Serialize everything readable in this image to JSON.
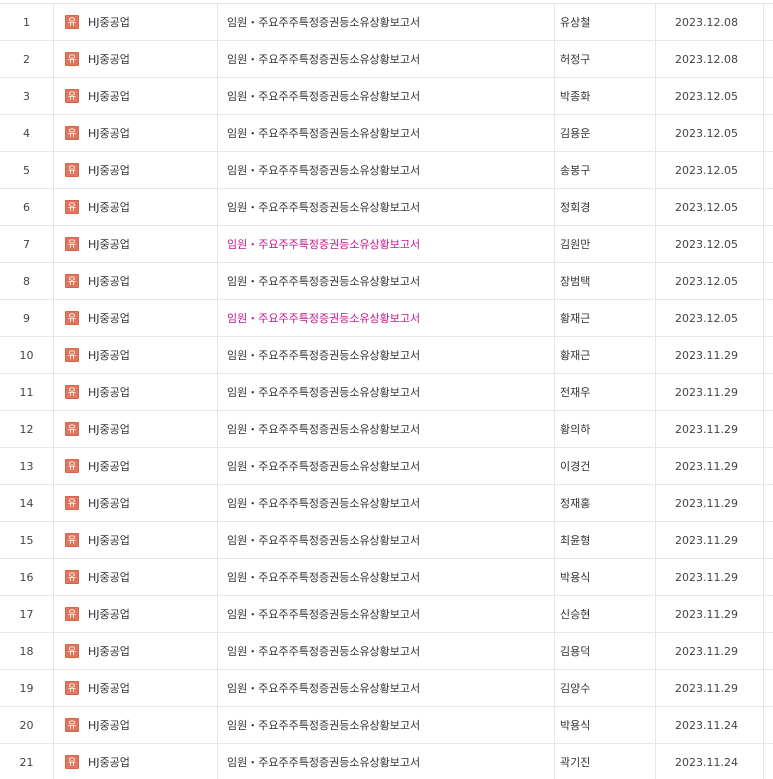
{
  "disclosure_table": {
    "rows": [
      {
        "no": "1",
        "market_badge": "유",
        "company": "HJ중공업",
        "report": "임원・주요주주특정증권등소유상황보고서",
        "filer": "유상철",
        "date": "2023.12.08",
        "highlighted": false
      },
      {
        "no": "2",
        "market_badge": "유",
        "company": "HJ중공업",
        "report": "임원・주요주주특정증권등소유상황보고서",
        "filer": "허정구",
        "date": "2023.12.08",
        "highlighted": false
      },
      {
        "no": "3",
        "market_badge": "유",
        "company": "HJ중공업",
        "report": "임원・주요주주특정증권등소유상황보고서",
        "filer": "박종화",
        "date": "2023.12.05",
        "highlighted": false
      },
      {
        "no": "4",
        "market_badge": "유",
        "company": "HJ중공업",
        "report": "임원・주요주주특정증권등소유상황보고서",
        "filer": "김용운",
        "date": "2023.12.05",
        "highlighted": false
      },
      {
        "no": "5",
        "market_badge": "유",
        "company": "HJ중공업",
        "report": "임원・주요주주특정증권등소유상황보고서",
        "filer": "송봉구",
        "date": "2023.12.05",
        "highlighted": false
      },
      {
        "no": "6",
        "market_badge": "유",
        "company": "HJ중공업",
        "report": "임원・주요주주특정증권등소유상황보고서",
        "filer": "정회경",
        "date": "2023.12.05",
        "highlighted": false
      },
      {
        "no": "7",
        "market_badge": "유",
        "company": "HJ중공업",
        "report": "임원・주요주주특정증권등소유상황보고서",
        "filer": "김원만",
        "date": "2023.12.05",
        "highlighted": true
      },
      {
        "no": "8",
        "market_badge": "유",
        "company": "HJ중공업",
        "report": "임원・주요주주특정증권등소유상황보고서",
        "filer": "장범택",
        "date": "2023.12.05",
        "highlighted": false
      },
      {
        "no": "9",
        "market_badge": "유",
        "company": "HJ중공업",
        "report": "임원・주요주주특정증권등소유상황보고서",
        "filer": "황재근",
        "date": "2023.12.05",
        "highlighted": true
      },
      {
        "no": "10",
        "market_badge": "유",
        "company": "HJ중공업",
        "report": "임원・주요주주특정증권등소유상황보고서",
        "filer": "황재근",
        "date": "2023.11.29",
        "highlighted": false
      },
      {
        "no": "11",
        "market_badge": "유",
        "company": "HJ중공업",
        "report": "임원・주요주주특정증권등소유상황보고서",
        "filer": "전재우",
        "date": "2023.11.29",
        "highlighted": false
      },
      {
        "no": "12",
        "market_badge": "유",
        "company": "HJ중공업",
        "report": "임원・주요주주특정증권등소유상황보고서",
        "filer": "황의하",
        "date": "2023.11.29",
        "highlighted": false
      },
      {
        "no": "13",
        "market_badge": "유",
        "company": "HJ중공업",
        "report": "임원・주요주주특정증권등소유상황보고서",
        "filer": "이경건",
        "date": "2023.11.29",
        "highlighted": false
      },
      {
        "no": "14",
        "market_badge": "유",
        "company": "HJ중공업",
        "report": "임원・주요주주특정증권등소유상황보고서",
        "filer": "정재홍",
        "date": "2023.11.29",
        "highlighted": false
      },
      {
        "no": "15",
        "market_badge": "유",
        "company": "HJ중공업",
        "report": "임원・주요주주특정증권등소유상황보고서",
        "filer": "최윤형",
        "date": "2023.11.29",
        "highlighted": false
      },
      {
        "no": "16",
        "market_badge": "유",
        "company": "HJ중공업",
        "report": "임원・주요주주특정증권등소유상황보고서",
        "filer": "박용식",
        "date": "2023.11.29",
        "highlighted": false
      },
      {
        "no": "17",
        "market_badge": "유",
        "company": "HJ중공업",
        "report": "임원・주요주주특정증권등소유상황보고서",
        "filer": "신승현",
        "date": "2023.11.29",
        "highlighted": false
      },
      {
        "no": "18",
        "market_badge": "유",
        "company": "HJ중공업",
        "report": "임원・주요주주특정증권등소유상황보고서",
        "filer": "김용덕",
        "date": "2023.11.29",
        "highlighted": false
      },
      {
        "no": "19",
        "market_badge": "유",
        "company": "HJ중공업",
        "report": "임원・주요주주특정증권등소유상황보고서",
        "filer": "김양수",
        "date": "2023.11.29",
        "highlighted": false
      },
      {
        "no": "20",
        "market_badge": "유",
        "company": "HJ중공업",
        "report": "임원・주요주주특정증권등소유상황보고서",
        "filer": "박용식",
        "date": "2023.11.24",
        "highlighted": false
      },
      {
        "no": "21",
        "market_badge": "유",
        "company": "HJ중공업",
        "report": "임원・주요주주특정증권등소유상황보고서",
        "filer": "곽기진",
        "date": "2023.11.24",
        "highlighted": false
      }
    ]
  },
  "colors": {
    "badge_bg": "#e0765e",
    "visited_link": "#c2188b",
    "text": "#333333",
    "border": "#e6e6e6"
  }
}
